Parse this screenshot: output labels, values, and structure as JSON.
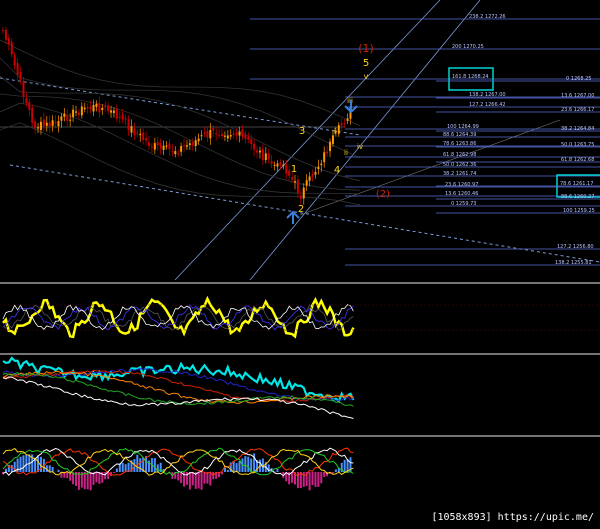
{
  "colors": {
    "background": "#000000",
    "candle_up": "#ff9900",
    "candle_down": "#cc0000",
    "fib_line": "#5d6fd8",
    "fib_label": "#b8c4ff",
    "channel": "#7a9bd8",
    "wave_label": "#ffd21a",
    "wave_label_alt": "#cc2200",
    "highlight_box": "#00d4d4",
    "osc1": "#ffff00",
    "osc2": "#00e5e5",
    "hist_pos": "#4a90ff",
    "hist_neg": "#cc2288",
    "panel_divider": "#bbbbbb",
    "arrow": "#3a7fd9"
  },
  "chart_data": [
    {
      "type": "candlestick",
      "title": "",
      "y_range": [
        1245,
        1280
      ],
      "fib_levels": [
        {
          "label": "238.2 1272.26"
        },
        {
          "label": "200 1270.25"
        },
        {
          "label": "161.8 1268.24",
          "boxed": true
        },
        {
          "label": "0 1268.25"
        },
        {
          "label": "138.2 1267.00"
        },
        {
          "label": "13.6 1267.00"
        },
        {
          "label": "127.2 1266.42"
        },
        {
          "label": "23.6 1266.17"
        },
        {
          "label": "100 1264.99"
        },
        {
          "label": "38.2 1264.84"
        },
        {
          "label": "88.6 1264.39"
        },
        {
          "label": "78.6 1263.86"
        },
        {
          "label": "50.0 1263.75"
        },
        {
          "label": "61.8 1262.98"
        },
        {
          "label": "61.8 1262.68"
        },
        {
          "label": "50.0 1262.36"
        },
        {
          "label": "38.2 1261.74"
        },
        {
          "label": "78.6 1261.17",
          "boxed": true
        },
        {
          "label": "23.6 1260.97"
        },
        {
          "label": "13.6 1260.46"
        },
        {
          "label": "88.6 1260.27"
        },
        {
          "label": "0 1259.73"
        },
        {
          "label": "100 1259.25"
        },
        {
          "label": "127.2 1256.80"
        },
        {
          "label": "138.2 1255.81"
        }
      ],
      "wave_labels": [
        {
          "text": "(1)",
          "style": "alt"
        },
        {
          "text": "5",
          "style": "main"
        },
        {
          "text": "v",
          "style": "main"
        },
        {
          "text": "iii",
          "style": "main"
        },
        {
          "text": "3",
          "style": "main"
        },
        {
          "text": "i",
          "style": "main"
        },
        {
          "text": "iv",
          "style": "main"
        },
        {
          "text": "ii",
          "style": "main"
        },
        {
          "text": "1",
          "style": "main"
        },
        {
          "text": "4",
          "style": "main"
        },
        {
          "text": "2",
          "style": "main"
        },
        {
          "text": "(2)",
          "style": "alt"
        }
      ]
    },
    {
      "type": "line",
      "title": "",
      "series": [
        {
          "color": "#ffff00"
        },
        {
          "color": "#555555"
        },
        {
          "color": "#4433ff"
        },
        {
          "color": "#ffffff"
        }
      ]
    },
    {
      "type": "line",
      "title": "",
      "series": [
        {
          "color": "#00e5e5"
        },
        {
          "color": "#2222cc"
        },
        {
          "color": "#cc2200"
        },
        {
          "color": "#ff8800"
        },
        {
          "color": "#22aa22"
        },
        {
          "color": "#ffffff"
        }
      ]
    },
    {
      "type": "bar",
      "title": "",
      "series": [
        {
          "color": "#4a90ff"
        },
        {
          "color": "#cc2288"
        },
        {
          "color": "#ff3300"
        },
        {
          "color": "#ffffff"
        },
        {
          "color": "#22cc22"
        },
        {
          "color": "#ffd21a"
        }
      ]
    }
  ],
  "credit": "[1058x893] https://upic.me/"
}
